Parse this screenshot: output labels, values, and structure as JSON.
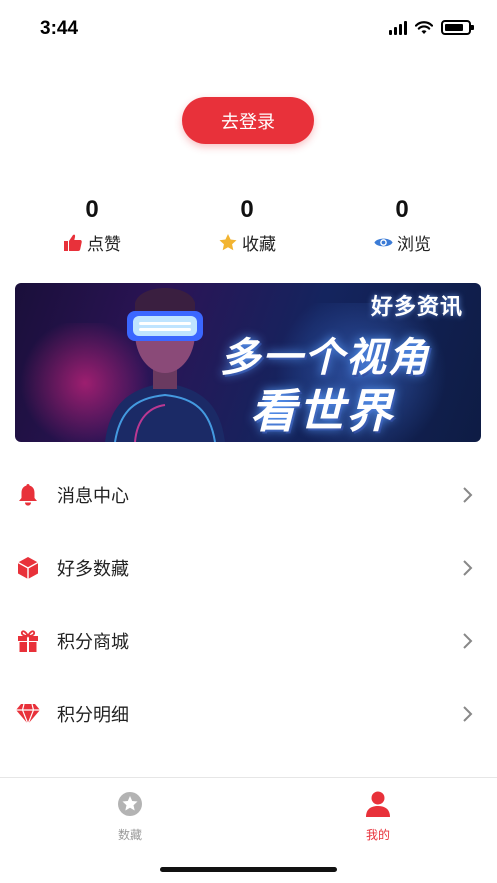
{
  "status_bar": {
    "time": "3:44",
    "battery_level": 0.8
  },
  "login": {
    "button_label": "去登录"
  },
  "stats": [
    {
      "count": "0",
      "label": "点赞",
      "icon": "thumbs-up-icon",
      "color": "#e8313a"
    },
    {
      "count": "0",
      "label": "收藏",
      "icon": "star-icon",
      "color": "#f2b431"
    },
    {
      "count": "0",
      "label": "浏览",
      "icon": "eye-icon",
      "color": "#3b7bd6"
    }
  ],
  "banner": {
    "brand": "好多资讯",
    "slogan_line1": "多一个视角",
    "slogan_line2": "看世界"
  },
  "menu": [
    {
      "label": "消息中心",
      "icon": "bell-icon"
    },
    {
      "label": "好多数藏",
      "icon": "cube-icon"
    },
    {
      "label": "积分商城",
      "icon": "gift-icon"
    },
    {
      "label": "积分明细",
      "icon": "diamond-icon"
    }
  ],
  "tab_bar": {
    "tabs": [
      {
        "label": "数藏",
        "icon": "star-circle-icon",
        "active": false
      },
      {
        "label": "我的",
        "icon": "person-icon",
        "active": true
      }
    ]
  },
  "colors": {
    "accent": "#e8313a",
    "inactive": "#9a9a9a"
  }
}
